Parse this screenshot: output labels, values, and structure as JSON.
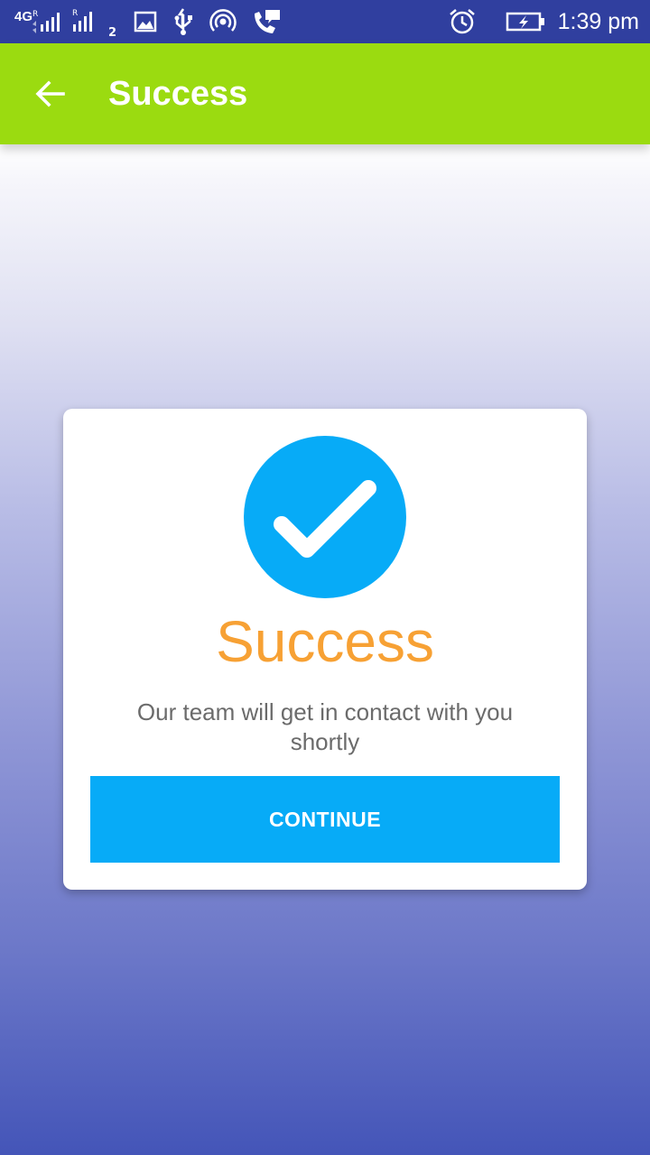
{
  "status_bar": {
    "network_type": "4G",
    "sim1_roaming": "R",
    "sim2_roaming": "R",
    "sim2_index": "2",
    "time": "1:39 pm",
    "icons": [
      "signal-sim1-icon",
      "signal-sim2-icon",
      "gallery-notification-icon",
      "usb-icon",
      "hotspot-icon",
      "call-chat-icon",
      "alarm-icon",
      "battery-charging-icon"
    ],
    "background_color": "#303f9f"
  },
  "app_bar": {
    "title": "Success",
    "back_icon": "arrow-back-icon",
    "background_color": "#9bdb10"
  },
  "card": {
    "icon": "check-circle-icon",
    "icon_color": "#07abf7",
    "title": "Success",
    "title_color": "#f7a134",
    "message": "Our team will get in contact with you shortly",
    "button_label": "CONTINUE",
    "button_color": "#07abf7"
  }
}
